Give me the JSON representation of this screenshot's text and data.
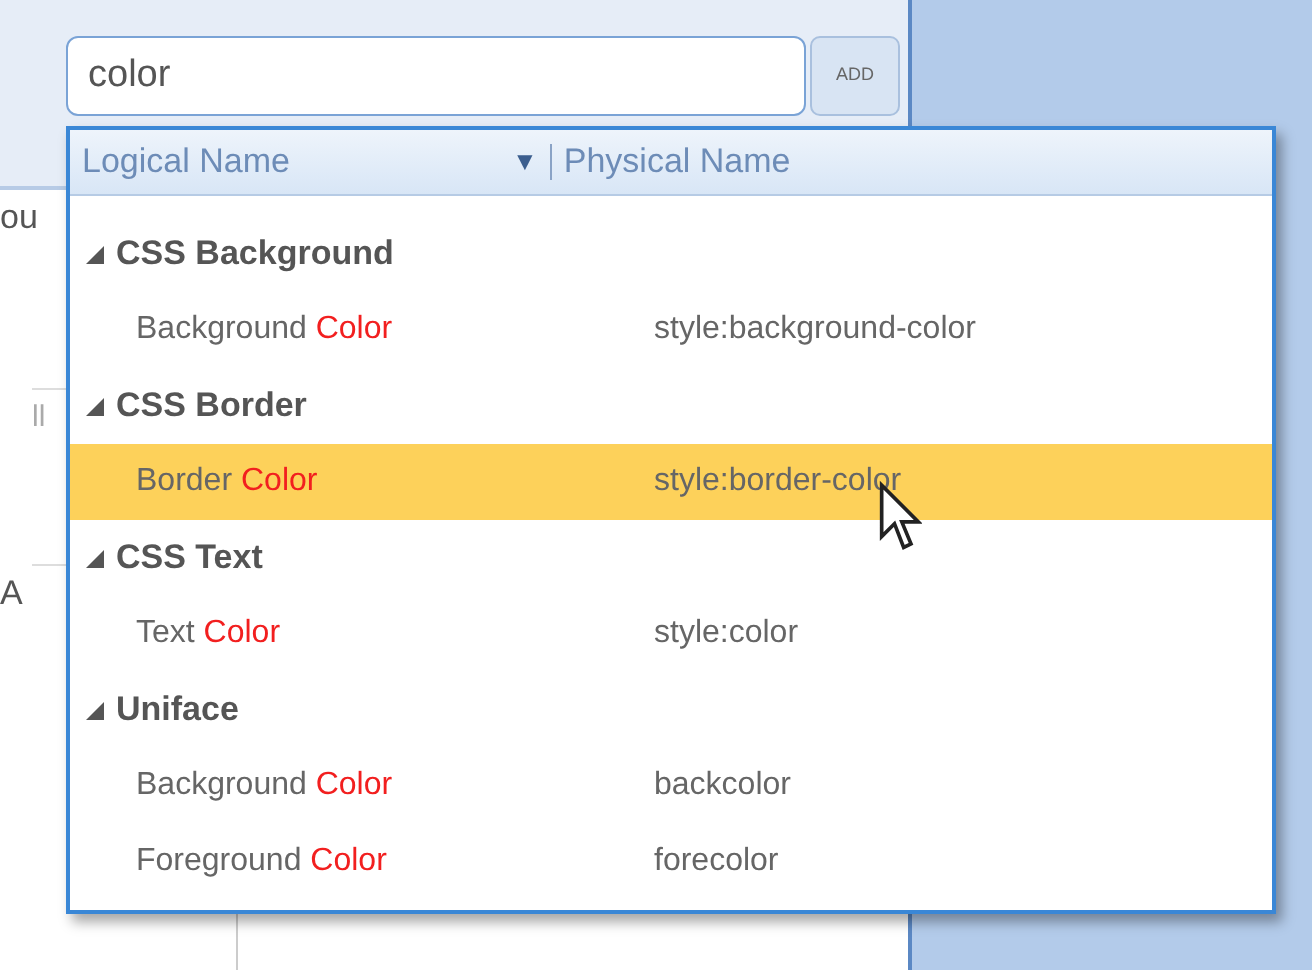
{
  "search": {
    "value": "color"
  },
  "add_button": "ADD",
  "background_fragments": [
    "ou",
    "ll",
    "A"
  ],
  "dropdown": {
    "columns": [
      "Logical Name",
      "Physical Name"
    ],
    "sort_icon": "▼",
    "groups": [
      {
        "name": "CSS Background",
        "expanded": true,
        "items": [
          {
            "name": "Background",
            "match": "Color",
            "physical": "style:background-color",
            "selected": false
          }
        ]
      },
      {
        "name": "CSS Border",
        "expanded": true,
        "items": [
          {
            "name": "Border",
            "match": "Color",
            "physical": "style:border-color",
            "selected": true
          }
        ]
      },
      {
        "name": "CSS Text",
        "expanded": true,
        "items": [
          {
            "name": "Text",
            "match": "Color",
            "physical": "style:color",
            "selected": false
          }
        ]
      },
      {
        "name": "Uniface",
        "expanded": true,
        "items": [
          {
            "name": "Background",
            "match": "Color",
            "physical": "backcolor",
            "selected": false
          },
          {
            "name": "Foreground",
            "match": "Color",
            "physical": "forecolor",
            "selected": false
          }
        ]
      }
    ]
  }
}
